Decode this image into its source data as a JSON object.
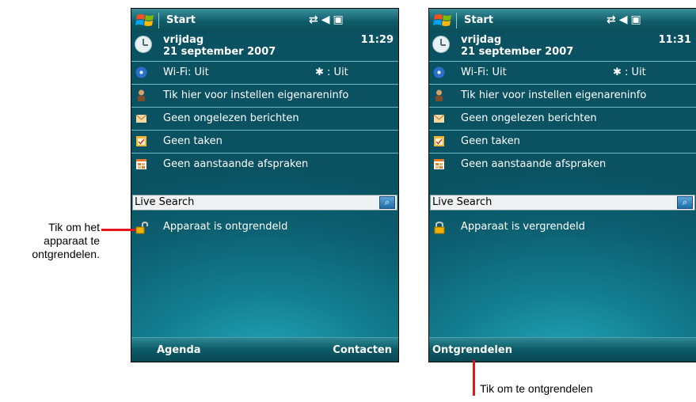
{
  "left_screen": {
    "title": "Start",
    "day": "vrijdag",
    "date": "21 september 2007",
    "time": "11:29",
    "wifi": "Wi-Fi: Uit",
    "bluetooth": ": Uit",
    "owner": "Tik hier voor instellen eigenareninfo",
    "messages": "Geen ongelezen berichten",
    "tasks": "Geen taken",
    "appointments": "Geen aanstaande afspraken",
    "search": "Live Search",
    "lock_status": "Apparaat is ontgrendeld",
    "softkey_left": "Agenda",
    "softkey_right": "Contacten"
  },
  "right_screen": {
    "title": "Start",
    "day": "vrijdag",
    "date": "21 september 2007",
    "time": "11:31",
    "wifi": "Wi-Fi: Uit",
    "bluetooth": ": Uit",
    "owner": "Tik hier voor instellen eigenareninfo",
    "messages": "Geen ongelezen berichten",
    "tasks": "Geen taken",
    "appointments": "Geen aanstaande afspraken",
    "search": "Live Search",
    "lock_status": "Apparaat is vergrendeld",
    "softkey_left": "Ontgrendelen"
  },
  "callouts": {
    "left_line1": "Tik om het",
    "left_line2": "apparaat te",
    "left_line3": "ontgrendelen.",
    "bottom": "Tik om te ontgrendelen"
  },
  "icons": {
    "bluetooth_glyph": "✱"
  },
  "colors": {
    "accent_red": "#e3141c",
    "screen_teal": "#0c5f70"
  }
}
